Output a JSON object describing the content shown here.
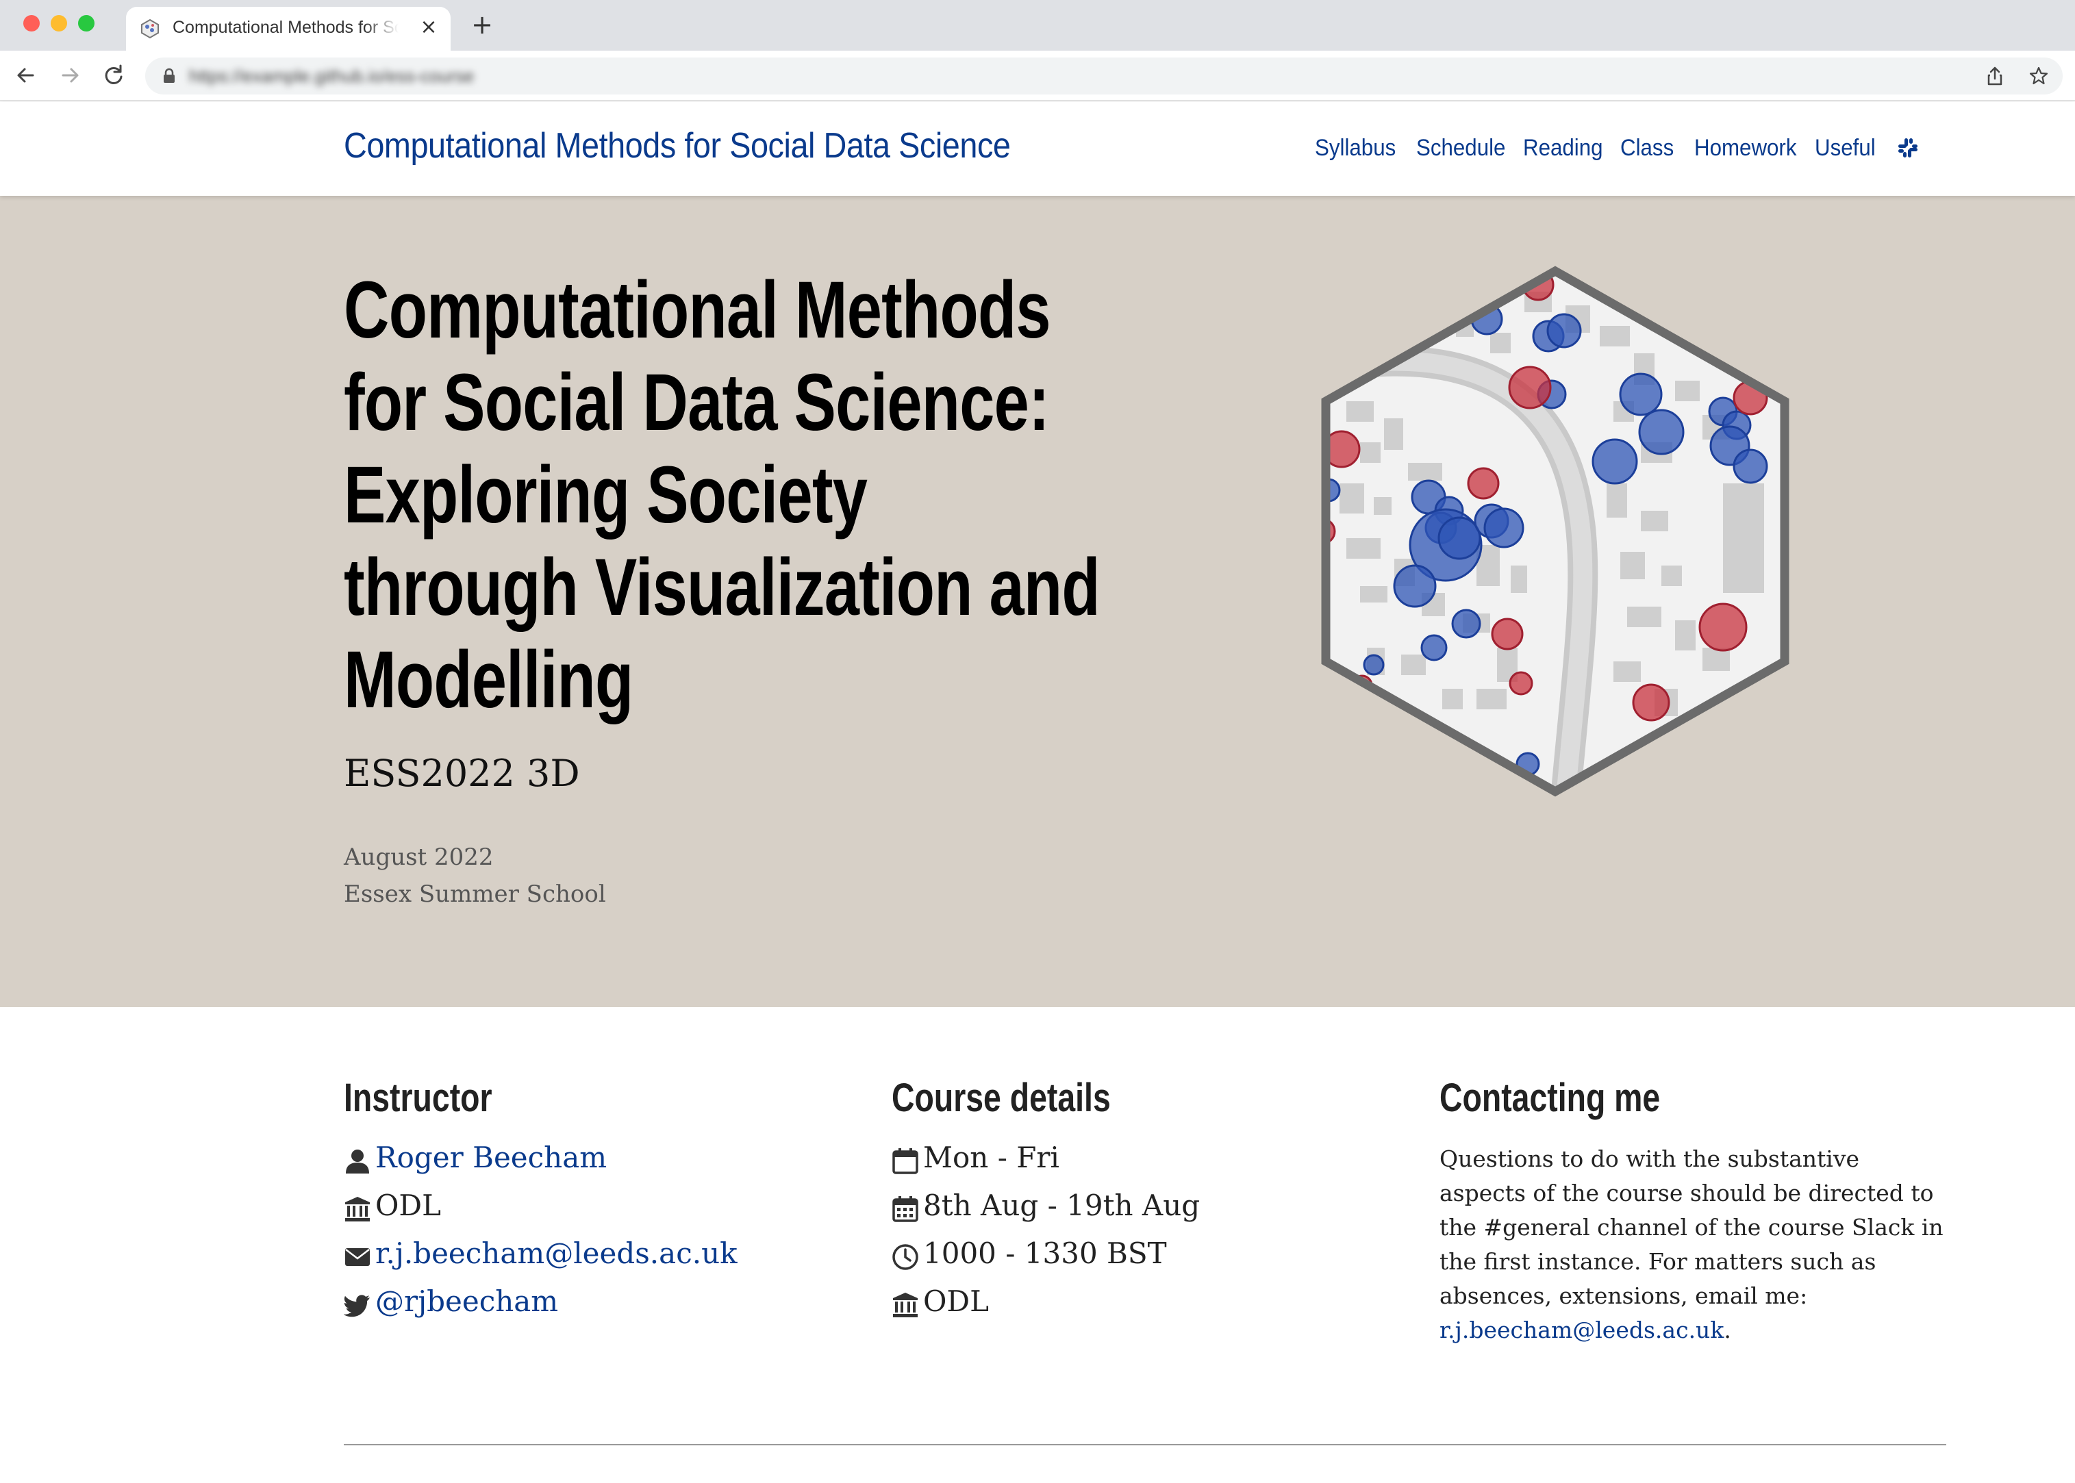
{
  "browser": {
    "tab_title": "Computational Methods for Social Data Science",
    "tab_close_glyph": "×",
    "new_tab_glyph": "+",
    "url": "https://example.github.io/ess-course"
  },
  "navbar": {
    "brand": "Computational Methods for Social Data Science",
    "links": [
      "Syllabus",
      "Schedule",
      "Reading",
      "Class",
      "Homework",
      "Useful"
    ],
    "slack_icon": "slack-icon"
  },
  "hero": {
    "title_lines": [
      "Computational Methods",
      "for Social Data Science:",
      "Exploring Society",
      "through Visualization and",
      "Modelling"
    ],
    "subtitle": "ESS2022 3D",
    "date": "August 2022",
    "school": "Essex Summer School"
  },
  "instructor": {
    "heading": "Instructor",
    "name": "Roger Beecham",
    "org": "ODL",
    "email": "r.j.beecham@leeds.ac.uk",
    "twitter": "@rjbeecham"
  },
  "course": {
    "heading": "Course details",
    "days": "Mon - Fri",
    "dates": "8th Aug - 19th Aug",
    "time": "1000 - 1330 BST",
    "location": "ODL"
  },
  "contact": {
    "heading": "Contacting me",
    "text": "Questions to do with the substantive aspects of the course should be directed to the #general channel of the course Slack in the first instance. For matters such as absences, extensions, email me:",
    "email": "r.j.beecham@leeds.ac.uk",
    "period": "."
  },
  "colors": {
    "link": "#0a3a8c",
    "hero_bg": "#d7d0c7",
    "point_blue": "#2f55b5",
    "point_red": "#c8333f"
  }
}
